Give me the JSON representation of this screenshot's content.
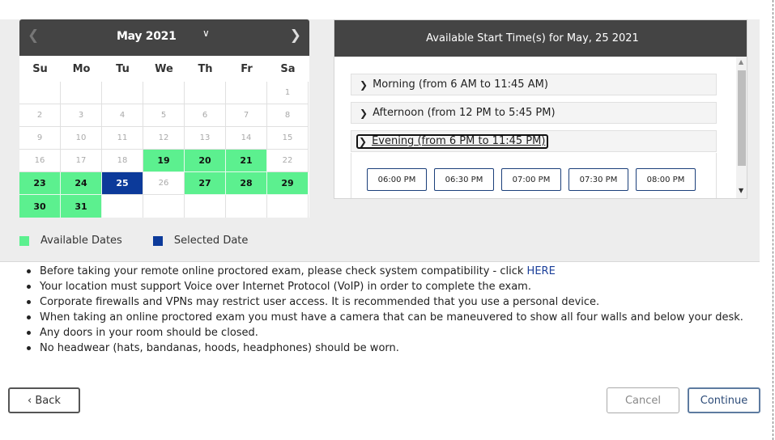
{
  "calendar": {
    "month_label": "May 2021",
    "prev_icon": "chevron-left-icon",
    "next_icon": "chevron-right-icon",
    "dropdown_icon": "chevron-down-icon",
    "weekdays": [
      "Su",
      "Mo",
      "Tu",
      "We",
      "Th",
      "Fr",
      "Sa"
    ],
    "weeks": [
      [
        "",
        "",
        "",
        "",
        "",
        "",
        "1"
      ],
      [
        "2",
        "3",
        "4",
        "5",
        "6",
        "7",
        "8"
      ],
      [
        "9",
        "10",
        "11",
        "12",
        "13",
        "14",
        "15"
      ],
      [
        "16",
        "17",
        "18",
        "19",
        "20",
        "21",
        "22"
      ],
      [
        "23",
        "24",
        "25",
        "26",
        "27",
        "28",
        "29"
      ],
      [
        "30",
        "31",
        "",
        "",
        "",
        "",
        ""
      ]
    ],
    "available_dates": [
      "19",
      "20",
      "21",
      "23",
      "24",
      "27",
      "28",
      "29",
      "30",
      "31"
    ],
    "selected_date": "25",
    "colors": {
      "available": "#5cf08f",
      "selected": "#0c3a9a",
      "header": "#444444"
    }
  },
  "legend": {
    "available_label": "Available Dates",
    "selected_label": "Selected Date"
  },
  "times": {
    "title": "Available Start Time(s) for May, 25 2021",
    "sections": [
      {
        "label": "Morning (from 6 AM to 11:45 AM)"
      },
      {
        "label": "Afternoon (from 12 PM to 5:45 PM)"
      },
      {
        "label": "Evening (from 6 PM to 11:45 PM)"
      }
    ],
    "slots": [
      "06:00 PM",
      "06:30 PM",
      "07:00 PM",
      "07:30 PM",
      "08:00 PM"
    ]
  },
  "notes": {
    "items": [
      "Before taking your remote online proctored exam, please check system compatibility - click",
      "Your location must support Voice over Internet Protocol (VoIP) in order to complete the exam.",
      "Corporate firewalls and VPNs may restrict user access. It is recommended that you use a personal device.",
      "When taking an online proctored exam you must have a camera that can be maneuvered to show all four walls and below your desk.",
      "Any doors in your room should be closed.",
      "No headwear (hats, bandanas, hoods, headphones) should be worn."
    ],
    "link_text": "HERE"
  },
  "buttons": {
    "back": "‹ Back",
    "cancel": "Cancel",
    "continue": "Continue"
  }
}
